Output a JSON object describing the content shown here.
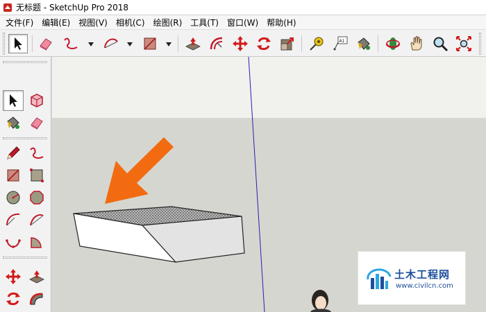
{
  "window": {
    "title": "无标题 - SketchUp Pro 2018"
  },
  "menu": {
    "items": [
      {
        "label": "文件(F)"
      },
      {
        "label": "编辑(E)"
      },
      {
        "label": "视图(V)"
      },
      {
        "label": "相机(C)"
      },
      {
        "label": "绘图(R)"
      },
      {
        "label": "工具(T)"
      },
      {
        "label": "窗口(W)"
      },
      {
        "label": "帮助(H)"
      }
    ]
  },
  "toolbar": {
    "tools": [
      {
        "icon": "select-arrow-icon",
        "selected": true
      },
      {
        "icon": "eraser-icon"
      },
      {
        "icon": "freehand-icon",
        "dropdown": true
      },
      {
        "icon": "arc-icon",
        "dropdown": true
      },
      {
        "icon": "rectangle-icon",
        "dropdown": true
      },
      {
        "icon": "push-pull-icon"
      },
      {
        "icon": "offset-icon"
      },
      {
        "icon": "move-icon"
      },
      {
        "icon": "rotate-icon"
      },
      {
        "icon": "scale-icon"
      },
      {
        "icon": "tape-measure-icon"
      },
      {
        "icon": "text-label-icon",
        "label": "A1"
      },
      {
        "icon": "paint-bucket-icon"
      },
      {
        "icon": "orbit-icon"
      },
      {
        "icon": "pan-hand-icon"
      },
      {
        "icon": "zoom-icon"
      },
      {
        "icon": "zoom-extents-icon"
      }
    ]
  },
  "sidebar": {
    "tools": [
      {
        "icon": "select-arrow-icon",
        "selected": true
      },
      {
        "icon": "make-component-icon"
      },
      {
        "icon": "paint-bucket-icon"
      },
      {
        "icon": "eraser-icon"
      },
      {
        "icon": "line-pencil-icon"
      },
      {
        "icon": "freehand-icon"
      },
      {
        "icon": "rectangle-icon"
      },
      {
        "icon": "rotated-rectangle-icon"
      },
      {
        "icon": "circle-icon"
      },
      {
        "icon": "polygon-icon"
      },
      {
        "icon": "arc-icon"
      },
      {
        "icon": "two-point-arc-icon"
      },
      {
        "icon": "three-point-arc-icon"
      },
      {
        "icon": "pie-icon"
      },
      {
        "icon": "move-icon"
      },
      {
        "icon": "push-pull-icon"
      },
      {
        "icon": "rotate-icon"
      },
      {
        "icon": "follow-me-icon"
      }
    ]
  },
  "colors": {
    "sky": "#f1f1ee",
    "ground": "#d6d6d0",
    "blue_axis": "#2020b0",
    "arrow": "#f26b11",
    "box_top": "#8a8a8a",
    "box_front": "#ffffff",
    "box_side": "#e3e3e3"
  },
  "watermark": {
    "name": "土木工程网",
    "url": "www.civilcn.com"
  }
}
